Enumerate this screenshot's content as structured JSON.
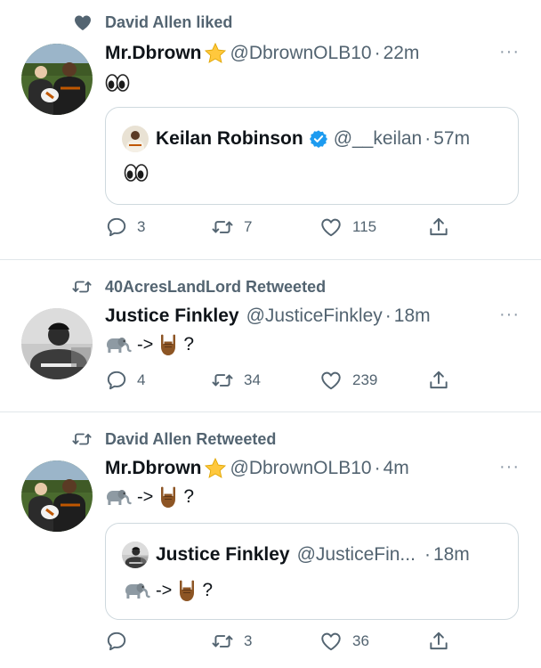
{
  "tweets": [
    {
      "context": "David Allen liked",
      "context_icon": "heart-icon",
      "author": {
        "name": "Mr.Dbrown",
        "badge": "star-emoji",
        "handle": "@DbrownOLB10",
        "sep": "·",
        "time": "22m"
      },
      "body_emoji": "eyes",
      "quote": {
        "author": {
          "name": "Keilan Robinson",
          "verified": true,
          "handle": "@__keilan",
          "sep": "·",
          "time": "57m"
        },
        "body_emoji": "eyes"
      },
      "actions": {
        "replies": "3",
        "retweets": "7",
        "likes": "115"
      }
    },
    {
      "context": "40AcresLandLord Retweeted",
      "context_icon": "retweet-icon",
      "author": {
        "name": "Justice Finkley",
        "handle": "@JusticeFinkley",
        "sep": "·",
        "time": "18m"
      },
      "body": {
        "arrow": "->",
        "q": "?"
      },
      "actions": {
        "replies": "4",
        "retweets": "34",
        "likes": "239"
      }
    },
    {
      "context": "David Allen Retweeted",
      "context_icon": "retweet-icon",
      "author": {
        "name": "Mr.Dbrown",
        "badge": "star-emoji",
        "handle": "@DbrownOLB10",
        "sep": "·",
        "time": "4m"
      },
      "body": {
        "arrow": "->",
        "q": "?"
      },
      "quote": {
        "author": {
          "name": "Justice Finkley",
          "handle": "@JusticeFin...",
          "sep": "·",
          "time": "18m"
        },
        "body": {
          "arrow": "->",
          "q": "?"
        }
      },
      "actions": {
        "replies": "",
        "retweets": "3",
        "likes": "36"
      }
    }
  ],
  "more_label": "···",
  "colors": {
    "text": "#0f1419",
    "muted": "#536471",
    "verified": "#1d9bf0",
    "border": "#cfd9de"
  }
}
